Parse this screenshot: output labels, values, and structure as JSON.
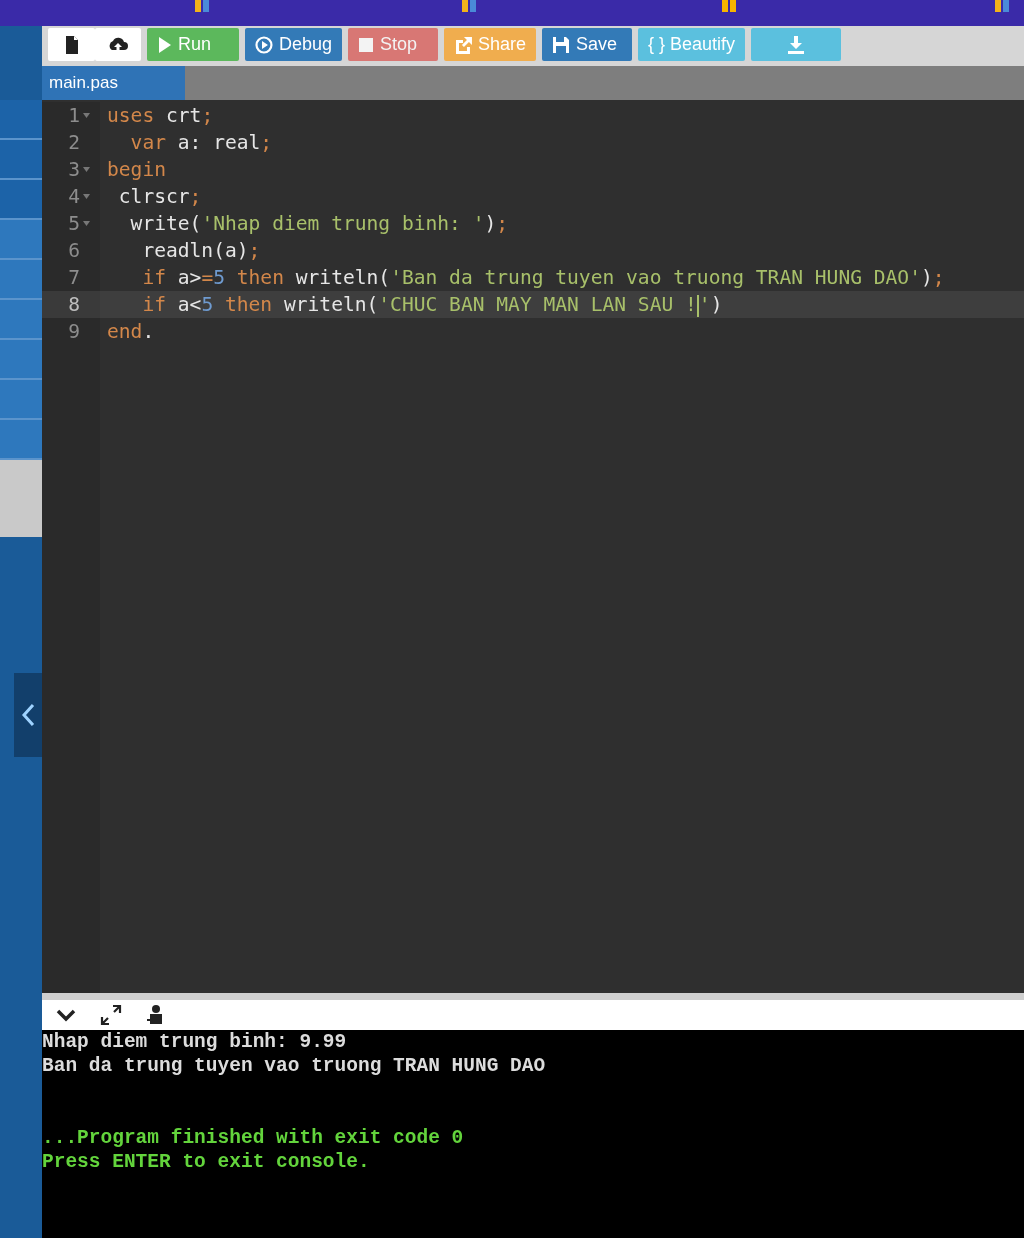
{
  "toolbar": {
    "buttons": [
      {
        "kind": "new-file",
        "disabled": false
      },
      {
        "kind": "upload",
        "disabled": false
      },
      {
        "kind": "run",
        "label": "Run",
        "disabled": false
      },
      {
        "kind": "debug",
        "label": "Debug",
        "disabled": false
      },
      {
        "kind": "stop",
        "label": "Stop",
        "disabled": true
      },
      {
        "kind": "share",
        "label": "Share",
        "disabled": false
      },
      {
        "kind": "save",
        "label": "Save",
        "disabled": false
      },
      {
        "kind": "beautify",
        "label": "{ } Beautify",
        "disabled": false
      },
      {
        "kind": "download",
        "disabled": false
      }
    ]
  },
  "tabs": [
    {
      "label": "main.pas",
      "selected": true
    }
  ],
  "editor": {
    "lines": [
      {
        "number": "1",
        "foldable": true,
        "active": false,
        "tokens": [
          {
            "kind": "keyword",
            "text": "uses"
          },
          {
            "kind": "plain",
            "text": " crt"
          },
          {
            "kind": "punct",
            "text": ";"
          }
        ]
      },
      {
        "number": "2",
        "foldable": false,
        "active": false,
        "tokens": [
          {
            "kind": "keyword",
            "text": "  var"
          },
          {
            "kind": "plain",
            "text": " a: real"
          },
          {
            "kind": "punct",
            "text": ";"
          }
        ]
      },
      {
        "number": "3",
        "foldable": true,
        "active": false,
        "tokens": [
          {
            "kind": "keyword",
            "text": "begin"
          }
        ]
      },
      {
        "number": "4",
        "foldable": true,
        "active": false,
        "tokens": [
          {
            "kind": "plain",
            "text": " clrscr"
          },
          {
            "kind": "punct",
            "text": ";"
          }
        ]
      },
      {
        "number": "5",
        "foldable": true,
        "active": false,
        "tokens": [
          {
            "kind": "plain",
            "text": "  write("
          },
          {
            "kind": "string",
            "text": "'Nhap diem trung binh: '"
          },
          {
            "kind": "plain",
            "text": ")"
          },
          {
            "kind": "punct",
            "text": ";"
          }
        ]
      },
      {
        "number": "6",
        "foldable": false,
        "active": false,
        "tokens": [
          {
            "kind": "plain",
            "text": "   readln(a)"
          },
          {
            "kind": "punct",
            "text": ";"
          }
        ]
      },
      {
        "number": "7",
        "foldable": false,
        "active": false,
        "tokens": [
          {
            "kind": "keyword",
            "text": "   if"
          },
          {
            "kind": "plain",
            "text": " a>"
          },
          {
            "kind": "punct",
            "text": "="
          },
          {
            "kind": "number",
            "text": "5"
          },
          {
            "kind": "keyword",
            "text": " then"
          },
          {
            "kind": "plain",
            "text": " writeln("
          },
          {
            "kind": "string",
            "text": "'Ban da trung tuyen vao truong TRAN HUNG DAO'"
          },
          {
            "kind": "plain",
            "text": ")"
          },
          {
            "kind": "punct",
            "text": ";"
          }
        ]
      },
      {
        "number": "8",
        "foldable": false,
        "active": true,
        "tokens": [
          {
            "kind": "keyword",
            "text": "   if"
          },
          {
            "kind": "plain",
            "text": " a<"
          },
          {
            "kind": "number",
            "text": "5"
          },
          {
            "kind": "keyword",
            "text": " then"
          },
          {
            "kind": "plain",
            "text": " writeln("
          },
          {
            "kind": "string",
            "text": "'CHUC BAN MAY MAN LAN SAU !"
          },
          {
            "kind": "cursor"
          },
          {
            "kind": "string",
            "text": "'"
          },
          {
            "kind": "plain",
            "text": ")"
          }
        ]
      },
      {
        "number": "9",
        "foldable": false,
        "active": false,
        "tokens": [
          {
            "kind": "keyword",
            "text": "end"
          },
          {
            "kind": "plain",
            "text": "."
          }
        ]
      }
    ]
  },
  "console": {
    "output": [
      "Nhap diem trung binh: 9.99",
      "Ban da trung tuyen vao truong TRAN HUNG DAO"
    ],
    "exit_message": [
      "...Program finished with exit code 0",
      "Press ENTER to exit console."
    ]
  }
}
